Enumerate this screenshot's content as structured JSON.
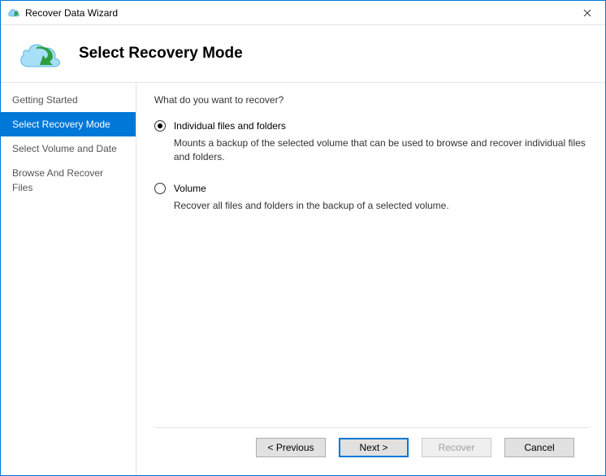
{
  "window": {
    "title": "Recover Data Wizard"
  },
  "header": {
    "page_title": "Select Recovery Mode"
  },
  "sidebar": {
    "items": [
      {
        "label": "Getting Started",
        "active": false
      },
      {
        "label": "Select Recovery Mode",
        "active": true
      },
      {
        "label": "Select Volume and Date",
        "active": false
      },
      {
        "label": "Browse And Recover Files",
        "active": false
      }
    ]
  },
  "content": {
    "question": "What do you want to recover?",
    "options": [
      {
        "label": "Individual files and folders",
        "description": "Mounts a backup of the selected volume that can be used to browse and recover individual files and folders.",
        "selected": true
      },
      {
        "label": "Volume",
        "description": "Recover all files and folders in the backup of a selected volume.",
        "selected": false
      }
    ]
  },
  "footer": {
    "previous": "< Previous",
    "next": "Next >",
    "recover": "Recover",
    "cancel": "Cancel"
  }
}
